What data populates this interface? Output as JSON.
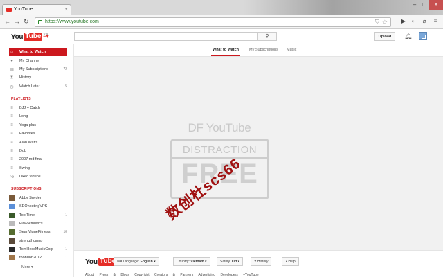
{
  "browser": {
    "tab_title": "YouTube",
    "url": "https://www.youtube.com"
  },
  "header": {
    "logo_you": "You",
    "logo_tube": "Tube",
    "logo_region": "VN",
    "upload_label": "Upload"
  },
  "sidebar": {
    "main_items": [
      {
        "label": "What to Watch",
        "count": "",
        "icon": "home-icon"
      },
      {
        "label": "My Channel",
        "count": "",
        "icon": "user-icon"
      },
      {
        "label": "My Subscriptions",
        "count": "72",
        "icon": "subscriptions-icon"
      },
      {
        "label": "History",
        "count": "",
        "icon": "history-icon"
      },
      {
        "label": "Watch Later",
        "count": "5",
        "icon": "clock-icon"
      }
    ],
    "playlists_heading": "PLAYLISTS",
    "playlists": [
      "BJJ + Catch",
      "Long",
      "Yoga plus",
      "Favorites",
      "Alan Watts",
      "Dub",
      "2007 md final",
      "Swing",
      "Liked videos"
    ],
    "subscriptions_heading": "SUBSCRIPTIONS",
    "subscriptions": [
      {
        "label": "Abby Snyder",
        "count": "",
        "color": "#7a5a3a"
      },
      {
        "label": "SEOhostingVPS",
        "count": "",
        "color": "#5b8fd8"
      },
      {
        "label": "ToolTime",
        "count": "1",
        "color": "#3a5a2a"
      },
      {
        "label": "Flow Athletics",
        "count": "1",
        "color": "#bbbbbb"
      },
      {
        "label": "SeanVigueFitness",
        "count": "10",
        "color": "#556b2f"
      },
      {
        "label": "strengthcamp",
        "count": "",
        "color": "#5a4a3a"
      },
      {
        "label": "TomHessMusicCorp",
        "count": "1",
        "color": "#2a2a2a"
      },
      {
        "label": "fbondon2012",
        "count": "1",
        "color": "#a0764a"
      }
    ],
    "more_label": "More"
  },
  "main": {
    "tabs": [
      "What to Watch",
      "My Subscriptions",
      "Music"
    ],
    "df_title": "DF YouTube",
    "df_top": "DISTRACTION",
    "df_big": "FREE"
  },
  "footer": {
    "language_label": "Language:",
    "language_value": "English",
    "country_label": "Country:",
    "country_value": "Vietnam",
    "safety_label": "Safety:",
    "safety_value": "Off",
    "history_label": "History",
    "help_label": "Help",
    "links": "About  Press & Blogs  Copyright  Creators & Partners  Advertising  Developers  +YouTube"
  },
  "watermark": "数创杜scs66"
}
